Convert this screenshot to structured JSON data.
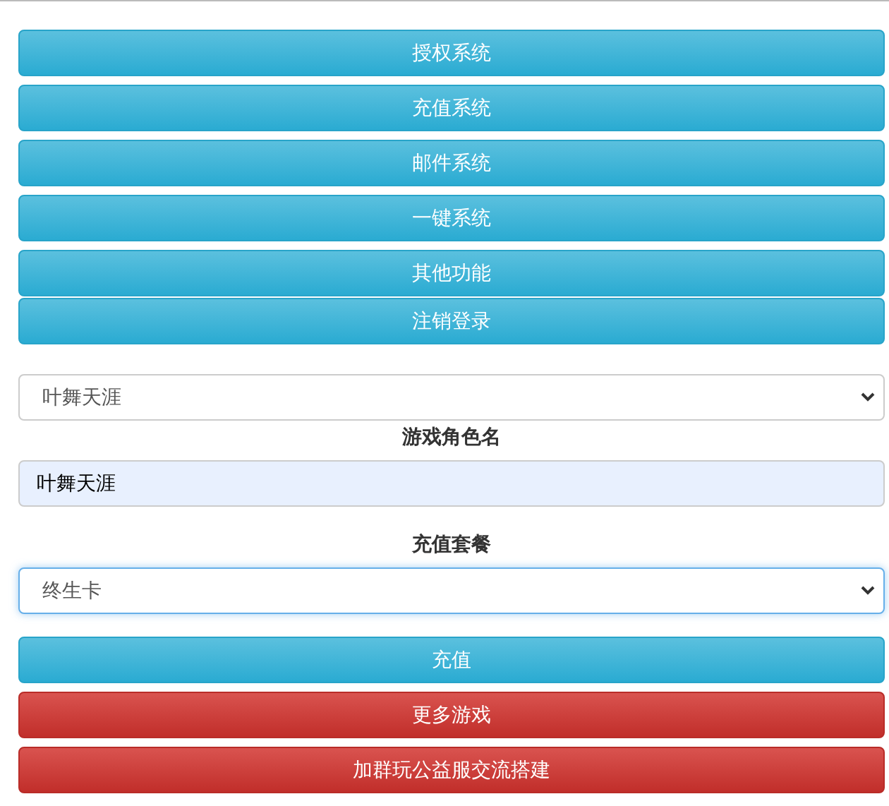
{
  "menu_buttons": [
    {
      "label": "授权系统",
      "kind": "info"
    },
    {
      "label": "充值系统",
      "kind": "info"
    },
    {
      "label": "邮件系统",
      "kind": "info"
    },
    {
      "label": "一键系统",
      "kind": "info"
    },
    {
      "label": "其他功能",
      "kind": "info"
    },
    {
      "label": "注销登录",
      "kind": "info"
    }
  ],
  "form": [
    {
      "kind": "select",
      "value": "叶舞天涯",
      "focused": false
    },
    {
      "kind": "label",
      "text": "游戏角色名"
    },
    {
      "kind": "input",
      "value": "叶舞天涯"
    },
    {
      "kind": "label",
      "text": "充值套餐"
    },
    {
      "kind": "select",
      "value": "终生卡",
      "focused": true
    }
  ],
  "action_buttons": [
    {
      "label": "充值",
      "kind": "info"
    },
    {
      "label": "更多游戏",
      "kind": "danger"
    },
    {
      "label": "加群玩公益服交流搭建",
      "kind": "danger"
    }
  ]
}
